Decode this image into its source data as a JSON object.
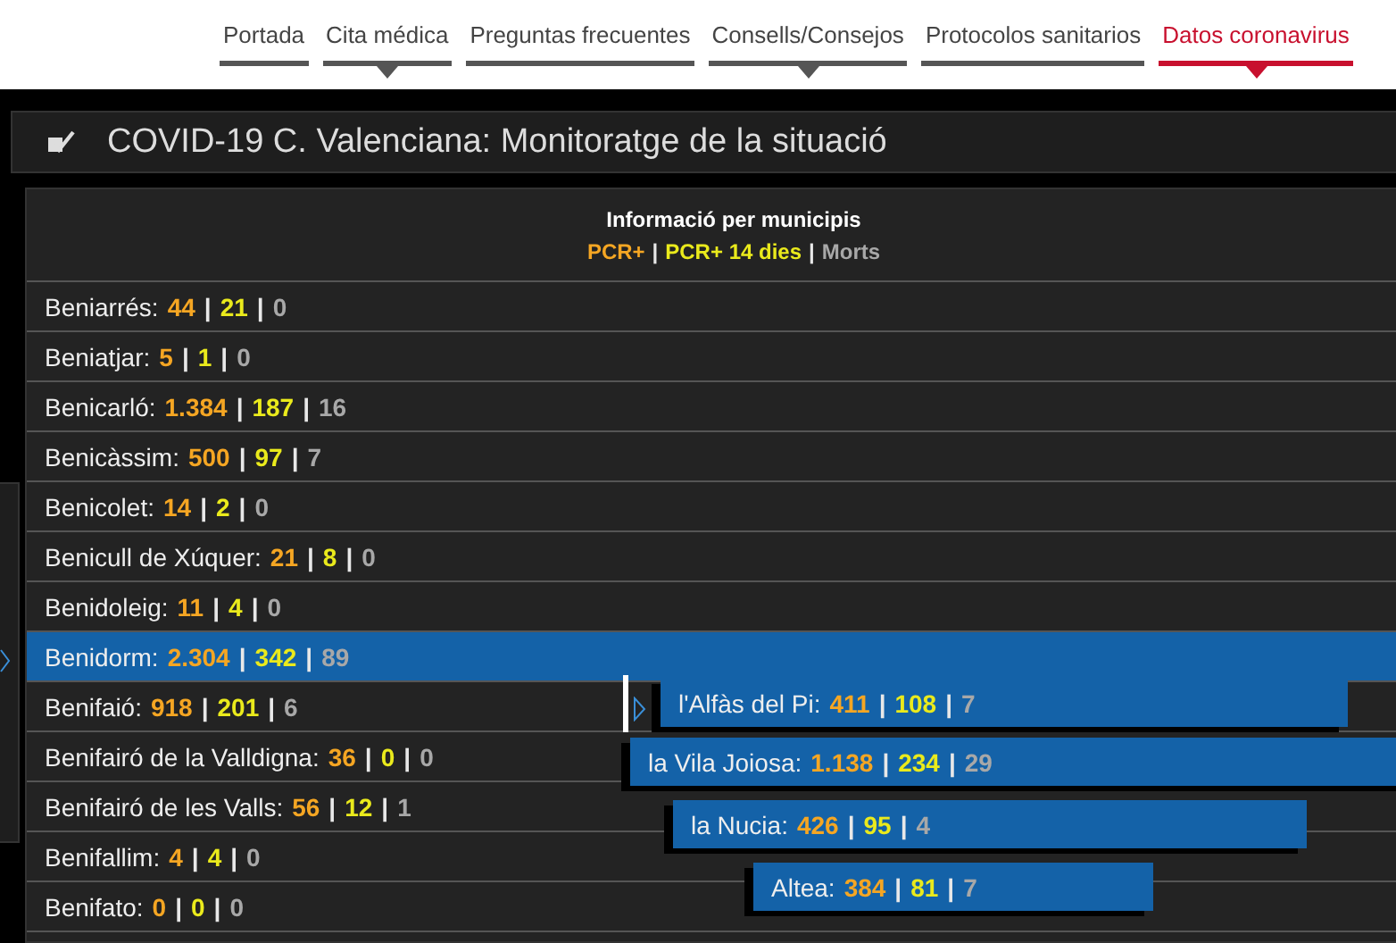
{
  "nav": [
    {
      "label": "Portada",
      "selected": false,
      "has_menu": false
    },
    {
      "label": "Cita médica",
      "selected": false,
      "has_menu": true
    },
    {
      "label": "Preguntas frecuentes",
      "selected": false,
      "has_menu": false
    },
    {
      "label": "Consells/Consejos",
      "selected": false,
      "has_menu": true
    },
    {
      "label": "Protocolos sanitarios",
      "selected": false,
      "has_menu": false
    },
    {
      "label": "Datos coronavirus",
      "selected": true,
      "has_menu": true
    }
  ],
  "panel_title": "COVID-19 C. Valenciana: Monitoratge de la situació",
  "list_header": {
    "title": "Informació per municipis",
    "legend": [
      {
        "label": "PCR+",
        "kind": "pcr"
      },
      {
        "label": "|",
        "kind": "sep"
      },
      {
        "label": "PCR+ 14 dies",
        "kind": "pcr14"
      },
      {
        "label": "|",
        "kind": "sep"
      },
      {
        "label": "Morts",
        "kind": "deaths"
      }
    ]
  },
  "rows": [
    {
      "selected": false,
      "parts": [
        {
          "text": "Beniarrés:",
          "kind": "name"
        },
        {
          "text": "44",
          "kind": "pcr"
        },
        {
          "text": "|",
          "kind": "sep"
        },
        {
          "text": "21",
          "kind": "pcr14"
        },
        {
          "text": "|",
          "kind": "sep"
        },
        {
          "text": "0",
          "kind": "deaths"
        }
      ]
    },
    {
      "selected": false,
      "parts": [
        {
          "text": "Beniatjar:",
          "kind": "name"
        },
        {
          "text": "5",
          "kind": "pcr"
        },
        {
          "text": "|",
          "kind": "sep"
        },
        {
          "text": "1",
          "kind": "pcr14"
        },
        {
          "text": "|",
          "kind": "sep"
        },
        {
          "text": "0",
          "kind": "deaths"
        }
      ]
    },
    {
      "selected": false,
      "parts": [
        {
          "text": "Benicarló:",
          "kind": "name"
        },
        {
          "text": "1.384",
          "kind": "pcr"
        },
        {
          "text": "|",
          "kind": "sep"
        },
        {
          "text": "187",
          "kind": "pcr14"
        },
        {
          "text": "|",
          "kind": "sep"
        },
        {
          "text": "16",
          "kind": "deaths"
        }
      ]
    },
    {
      "selected": false,
      "parts": [
        {
          "text": "Benicàssim:",
          "kind": "name"
        },
        {
          "text": "500",
          "kind": "pcr"
        },
        {
          "text": "|",
          "kind": "sep"
        },
        {
          "text": "97",
          "kind": "pcr14"
        },
        {
          "text": "|",
          "kind": "sep"
        },
        {
          "text": "7",
          "kind": "deaths"
        }
      ]
    },
    {
      "selected": false,
      "parts": [
        {
          "text": "Benicolet:",
          "kind": "name"
        },
        {
          "text": "14",
          "kind": "pcr"
        },
        {
          "text": "|",
          "kind": "sep"
        },
        {
          "text": "2",
          "kind": "pcr14"
        },
        {
          "text": "|",
          "kind": "sep"
        },
        {
          "text": "0",
          "kind": "deaths"
        }
      ]
    },
    {
      "selected": false,
      "parts": [
        {
          "text": "Benicull de Xúquer:",
          "kind": "name"
        },
        {
          "text": "21",
          "kind": "pcr"
        },
        {
          "text": "|",
          "kind": "sep"
        },
        {
          "text": "8",
          "kind": "pcr14"
        },
        {
          "text": "|",
          "kind": "sep"
        },
        {
          "text": "0",
          "kind": "deaths"
        }
      ]
    },
    {
      "selected": false,
      "parts": [
        {
          "text": "Benidoleig:",
          "kind": "name"
        },
        {
          "text": "11",
          "kind": "pcr"
        },
        {
          "text": "|",
          "kind": "sep"
        },
        {
          "text": "4",
          "kind": "pcr14"
        },
        {
          "text": "|",
          "kind": "sep"
        },
        {
          "text": "0",
          "kind": "deaths"
        }
      ]
    },
    {
      "selected": true,
      "parts": [
        {
          "text": "Benidorm:",
          "kind": "name"
        },
        {
          "text": "2.304",
          "kind": "pcr"
        },
        {
          "text": "|",
          "kind": "sep"
        },
        {
          "text": "342",
          "kind": "pcr14"
        },
        {
          "text": "|",
          "kind": "sep"
        },
        {
          "text": "89",
          "kind": "deaths"
        }
      ]
    },
    {
      "selected": false,
      "parts": [
        {
          "text": "Benifaió:",
          "kind": "name"
        },
        {
          "text": "918",
          "kind": "pcr"
        },
        {
          "text": "|",
          "kind": "sep"
        },
        {
          "text": "201",
          "kind": "pcr14"
        },
        {
          "text": "|",
          "kind": "sep"
        },
        {
          "text": "6",
          "kind": "deaths"
        }
      ]
    },
    {
      "selected": false,
      "parts": [
        {
          "text": "Benifairó de la Valldigna:",
          "kind": "name"
        },
        {
          "text": "36",
          "kind": "pcr"
        },
        {
          "text": "|",
          "kind": "sep"
        },
        {
          "text": "0",
          "kind": "pcr14"
        },
        {
          "text": "|",
          "kind": "sep"
        },
        {
          "text": "0",
          "kind": "deaths"
        }
      ]
    },
    {
      "selected": false,
      "parts": [
        {
          "text": "Benifairó de les Valls:",
          "kind": "name"
        },
        {
          "text": "56",
          "kind": "pcr"
        },
        {
          "text": "|",
          "kind": "sep"
        },
        {
          "text": "12",
          "kind": "pcr14"
        },
        {
          "text": "|",
          "kind": "sep"
        },
        {
          "text": "1",
          "kind": "deaths"
        }
      ]
    },
    {
      "selected": false,
      "parts": [
        {
          "text": "Benifallim:",
          "kind": "name"
        },
        {
          "text": "4",
          "kind": "pcr"
        },
        {
          "text": "|",
          "kind": "sep"
        },
        {
          "text": "4",
          "kind": "pcr14"
        },
        {
          "text": "|",
          "kind": "sep"
        },
        {
          "text": "0",
          "kind": "deaths"
        }
      ]
    },
    {
      "selected": false,
      "parts": [
        {
          "text": "Benifato:",
          "kind": "name"
        },
        {
          "text": "0",
          "kind": "pcr"
        },
        {
          "text": "|",
          "kind": "sep"
        },
        {
          "text": "0",
          "kind": "pcr14"
        },
        {
          "text": "|",
          "kind": "sep"
        },
        {
          "text": "0",
          "kind": "deaths"
        }
      ]
    }
  ],
  "overlays": [
    {
      "parts": [
        {
          "text": "l'Alfàs del Pi:",
          "kind": "name"
        },
        {
          "text": "411",
          "kind": "pcr"
        },
        {
          "text": "|",
          "kind": "sep"
        },
        {
          "text": "108",
          "kind": "pcr14"
        },
        {
          "text": "|",
          "kind": "sep"
        },
        {
          "text": "7",
          "kind": "deaths"
        }
      ]
    },
    {
      "parts": [
        {
          "text": "la Vila Joiosa:",
          "kind": "name"
        },
        {
          "text": "1.138",
          "kind": "pcr"
        },
        {
          "text": "|",
          "kind": "sep"
        },
        {
          "text": "234",
          "kind": "pcr14"
        },
        {
          "text": "|",
          "kind": "sep"
        },
        {
          "text": "29",
          "kind": "deaths"
        }
      ]
    },
    {
      "parts": [
        {
          "text": "la Nucia:",
          "kind": "name"
        },
        {
          "text": "426",
          "kind": "pcr"
        },
        {
          "text": "|",
          "kind": "sep"
        },
        {
          "text": "95",
          "kind": "pcr14"
        },
        {
          "text": "|",
          "kind": "sep"
        },
        {
          "text": "4",
          "kind": "deaths"
        }
      ]
    },
    {
      "parts": [
        {
          "text": "Altea:",
          "kind": "name"
        },
        {
          "text": "384",
          "kind": "pcr"
        },
        {
          "text": "|",
          "kind": "sep"
        },
        {
          "text": "81",
          "kind": "pcr14"
        },
        {
          "text": "|",
          "kind": "sep"
        },
        {
          "text": "7",
          "kind": "deaths"
        }
      ]
    }
  ]
}
